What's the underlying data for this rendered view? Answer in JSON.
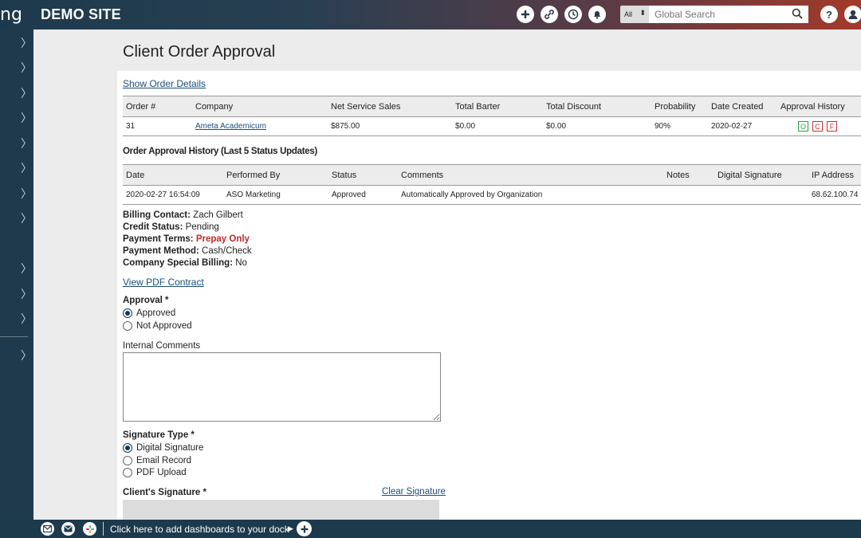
{
  "header": {
    "logo_fragment": "ng",
    "site_title": "DEMO SITE",
    "icons": [
      "plus-icon",
      "link-icon",
      "clock-icon",
      "bell-icon"
    ],
    "search_scope": "All",
    "search_placeholder": "Global Search",
    "help_label": "?"
  },
  "sidebar": {
    "chevron": "〉",
    "item_count": 12
  },
  "page": {
    "title": "Client Order Approval",
    "show_details_link": "Show Order Details"
  },
  "order_table": {
    "headers": [
      "Order #",
      "Company",
      "Net Service Sales",
      "Total Barter",
      "Total Discount",
      "Probability",
      "Date Created",
      "Approval History"
    ],
    "row": {
      "order_no": "31",
      "company": "Ameta Academicum",
      "net_service_sales": "$875.00",
      "total_barter": "$0.00",
      "total_discount": "$0.00",
      "probability": "90%",
      "date_created": "2020-02-27",
      "approval_badges": [
        "O",
        "C",
        "F"
      ]
    }
  },
  "history": {
    "heading": "Order Approval History (Last 5 Status Updates)",
    "headers": [
      "Date",
      "Performed By",
      "Status",
      "Comments",
      "Notes",
      "Digital Signature",
      "IP Address"
    ],
    "row": {
      "date": "2020-02-27 16:54:09",
      "performed_by": "ASO Marketing",
      "status": "Approved",
      "comments": "Automatically Approved by Organization",
      "notes": "",
      "digital_signature": "",
      "ip_address": "68.62.100.74"
    }
  },
  "billing": {
    "billing_contact_label": "Billing Contact:",
    "billing_contact": "Zach Gilbert",
    "credit_status_label": "Credit Status:",
    "credit_status": "Pending",
    "payment_terms_label": "Payment Terms:",
    "payment_terms": "Prepay Only",
    "payment_method_label": "Payment Method:",
    "payment_method": "Cash/Check",
    "special_billing_label": "Company Special Billing:",
    "special_billing": "No"
  },
  "contract_link": "View PDF Contract",
  "approval": {
    "label": "Approval *",
    "options": [
      "Approved",
      "Not Approved"
    ],
    "selected": "Approved"
  },
  "internal_comments": {
    "label": "Internal Comments",
    "value": ""
  },
  "signature_type": {
    "label": "Signature Type *",
    "options": [
      "Digital Signature",
      "Email Record",
      "PDF Upload"
    ],
    "selected": "Digital Signature"
  },
  "client_signature": {
    "label": "Client's Signature *",
    "clear_link": "Clear Signature"
  },
  "dock": {
    "text": "Click here to add dashboards to your dock",
    "icons": [
      "mail-icon",
      "email-circle-icon",
      "slack-icon"
    ]
  },
  "colors": {
    "sidebar": "#1f3a4d",
    "accent_link": "#1a4f7a",
    "red": "#c62828",
    "badge_green": "#2ea043",
    "badge_red": "#cf2e2e"
  }
}
